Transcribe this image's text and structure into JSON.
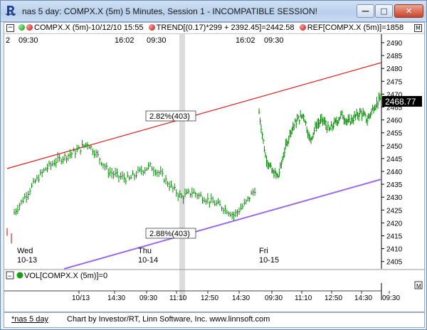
{
  "window": {
    "title": "nas 5 day: COMPX.X (5m) 5 Minutes, Session 1 - INCOMPATIBLE SESSION!",
    "min_label": "—",
    "max_label": "□",
    "close_label": "✕"
  },
  "legend": {
    "main_series": "COMPX.X (5m)-10/12/10 15:55",
    "trend": "TREND[(0.17)*299 + 2392.45]=2442.58",
    "ref": "REF[COMPX.X (5m)]=1858",
    "max_box": "M"
  },
  "top_axis": [
    {
      "label": "2"
    },
    {
      "label": "09:30"
    },
    {
      "label": "16:02"
    },
    {
      "label": "09:30"
    },
    {
      "label": "16:02"
    },
    {
      "label": "09:30"
    }
  ],
  "price_axis": {
    "ticks": [
      "2490",
      "2485",
      "2480",
      "2475",
      "2470",
      "2465",
      "2460",
      "2455",
      "2450",
      "2445",
      "2440",
      "2435",
      "2430",
      "2425",
      "2420",
      "2415",
      "2410",
      "2405"
    ],
    "last_price": "2468.77",
    "colors": {
      "last_price_bg": "#000000",
      "last_price_fg": "#ffffff"
    }
  },
  "day_labels": [
    {
      "day": "Wed",
      "date": "10-13"
    },
    {
      "day": "Thu",
      "date": "10-14"
    },
    {
      "day": "Fri",
      "date": "10-15"
    }
  ],
  "annotations": {
    "upper_pct": "2.82%(403)",
    "lower_pct": "2.88%(403)"
  },
  "volume_panel": {
    "legend": "VOL[COMPX.X (5m)]=0",
    "max_box": "M"
  },
  "time_axis": [
    "10/13",
    "14:30",
    "09:30",
    "11:10",
    "12:50",
    "14:30",
    "09:30",
    "11:10",
    "12:50",
    "14:30",
    "09:30"
  ],
  "status_bar": {
    "tab_label": "*nas 5 day",
    "credit": "Chart by Investor/RT, Linn Software, Inc. www.linnsoft.com"
  },
  "colors": {
    "upper_trend": "#e02020",
    "lower_trend": "#9a6ae8",
    "bars": "#008a00",
    "session_marker": "#d9d9d9"
  },
  "chart_data": {
    "type": "line",
    "title": "",
    "ylim": [
      2400,
      2492
    ],
    "series": [
      {
        "values": [
          2424,
          2430,
          2436,
          2441,
          2444,
          2446,
          2448,
          2451,
          2446,
          2440,
          2438,
          2437,
          2440,
          2442,
          2439,
          2434,
          2430,
          2432,
          2430,
          2428,
          2426,
          2423,
          2427,
          2433
        ]
      },
      {
        "values": [
          2463,
          2446,
          2440,
          2438,
          2448,
          2456,
          2460,
          2462,
          2452,
          2458,
          2460,
          2456,
          2459,
          2462,
          2459,
          2461,
          2463,
          2460,
          2465,
          2468
        ]
      }
    ]
  }
}
